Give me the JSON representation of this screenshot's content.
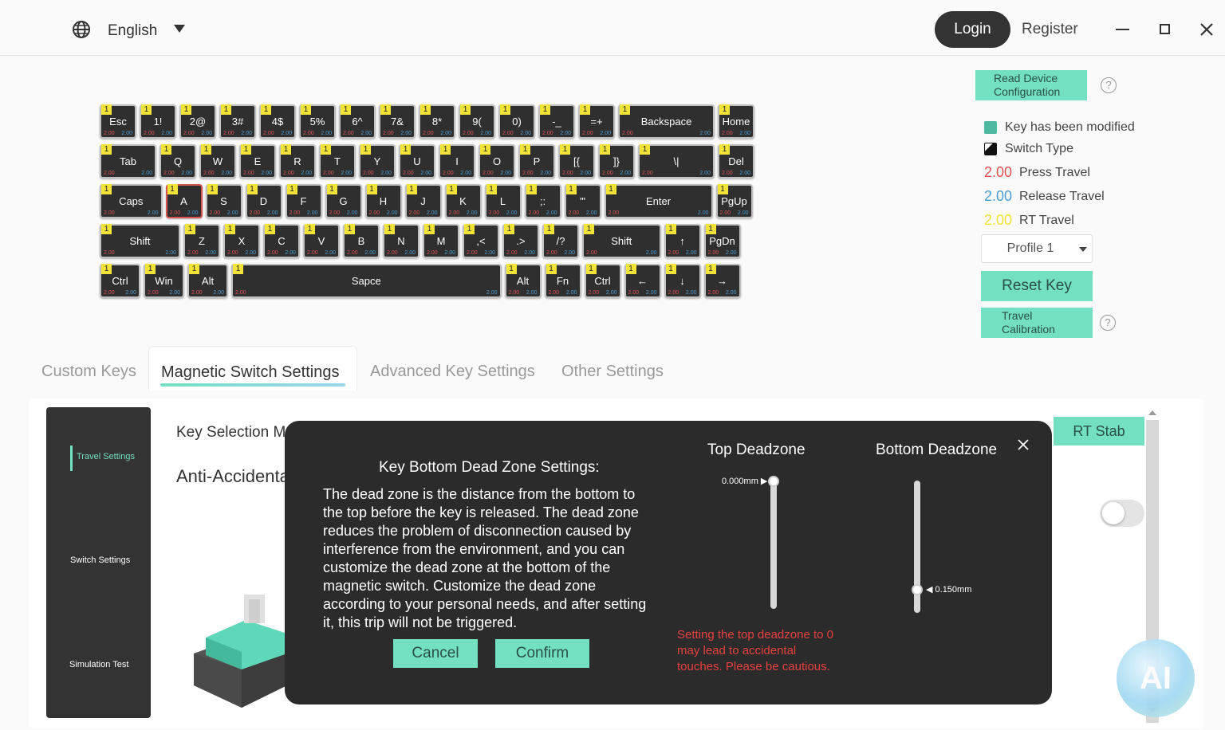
{
  "header": {
    "language": "English",
    "login": "Login",
    "register": "Register"
  },
  "keyboard": {
    "badge": "1",
    "press_value": "2.00",
    "rt_value": "2.00",
    "rows": [
      [
        "Esc",
        "1!",
        "2@",
        "3#",
        "4$",
        "5%",
        "6^",
        "7&",
        "8*",
        "9(",
        "0)",
        "-_",
        "=+",
        "Backspace",
        "Home"
      ],
      [
        "Tab",
        "Q",
        "W",
        "E",
        "R",
        "T",
        "Y",
        "U",
        "I",
        "O",
        "P",
        "[{",
        "]}",
        "\\|",
        "Del"
      ],
      [
        "Caps",
        "A",
        "S",
        "D",
        "F",
        "G",
        "H",
        "J",
        "K",
        "L",
        ";:",
        "'\"",
        "Enter",
        "PgUp"
      ],
      [
        "Shift",
        "Z",
        "X",
        "C",
        "V",
        "B",
        "N",
        "M",
        ",<",
        ".>",
        "/?",
        "Shift",
        "↑",
        "PgDn"
      ],
      [
        "Ctrl",
        "Win",
        "Alt",
        "Sapce",
        "Alt",
        "Fn",
        "Ctrl",
        "←",
        "↓",
        "→"
      ]
    ]
  },
  "right_panel": {
    "read_device": [
      "Read Device",
      "Configuration"
    ],
    "help": "?",
    "legend": {
      "modified": "Key has been modified",
      "switch_type": "Switch Type",
      "press_num": "2.00",
      "press_label": "Press Travel",
      "release_num": "2.00",
      "release_label": "Release Travel",
      "rt_num": "2.00",
      "rt_label": "RT Travel"
    },
    "profile": "Profile 1",
    "reset": "Reset Key",
    "calibration": [
      "Travel",
      "Calibration"
    ]
  },
  "tabs": {
    "custom": "Custom Keys",
    "magnetic": "Magnetic Switch Settings",
    "advanced": "Advanced Key Settings",
    "other": "Other Settings"
  },
  "side_nav": {
    "travel": "Travel Settings",
    "switch": "Switch Settings",
    "simulation": "Simulation Test"
  },
  "content": {
    "key_selection": "Key Selection Me",
    "anti_accidental": "Anti-Accidenta",
    "rt_stab": "RT Stab",
    "ai": "AI"
  },
  "modal": {
    "title": "Key Bottom Dead Zone Settings:",
    "description": "The dead zone is the distance from the bottom to the top before the key is released. The dead zone reduces the problem of disconnection caused by interference from the environment, and you can customize the dead zone at the bottom of the magnetic switch. Customize the dead zone according to your personal needs, and after setting it, this trip will not be triggered.",
    "cancel": "Cancel",
    "confirm": "Confirm",
    "top_deadzone": "Top Deadzone",
    "bottom_deadzone": "Bottom Deadzone",
    "top_value": "0.000mm",
    "bottom_value": "0.150mm",
    "warning": "Setting the top deadzone to 0 may lead to accidental touches. Please be cautious."
  },
  "colors": {
    "accent": "#74e0c2",
    "press": "#e05252",
    "release": "#4a9ed4",
    "rt": "#f1e338",
    "warning": "#e8403f"
  }
}
